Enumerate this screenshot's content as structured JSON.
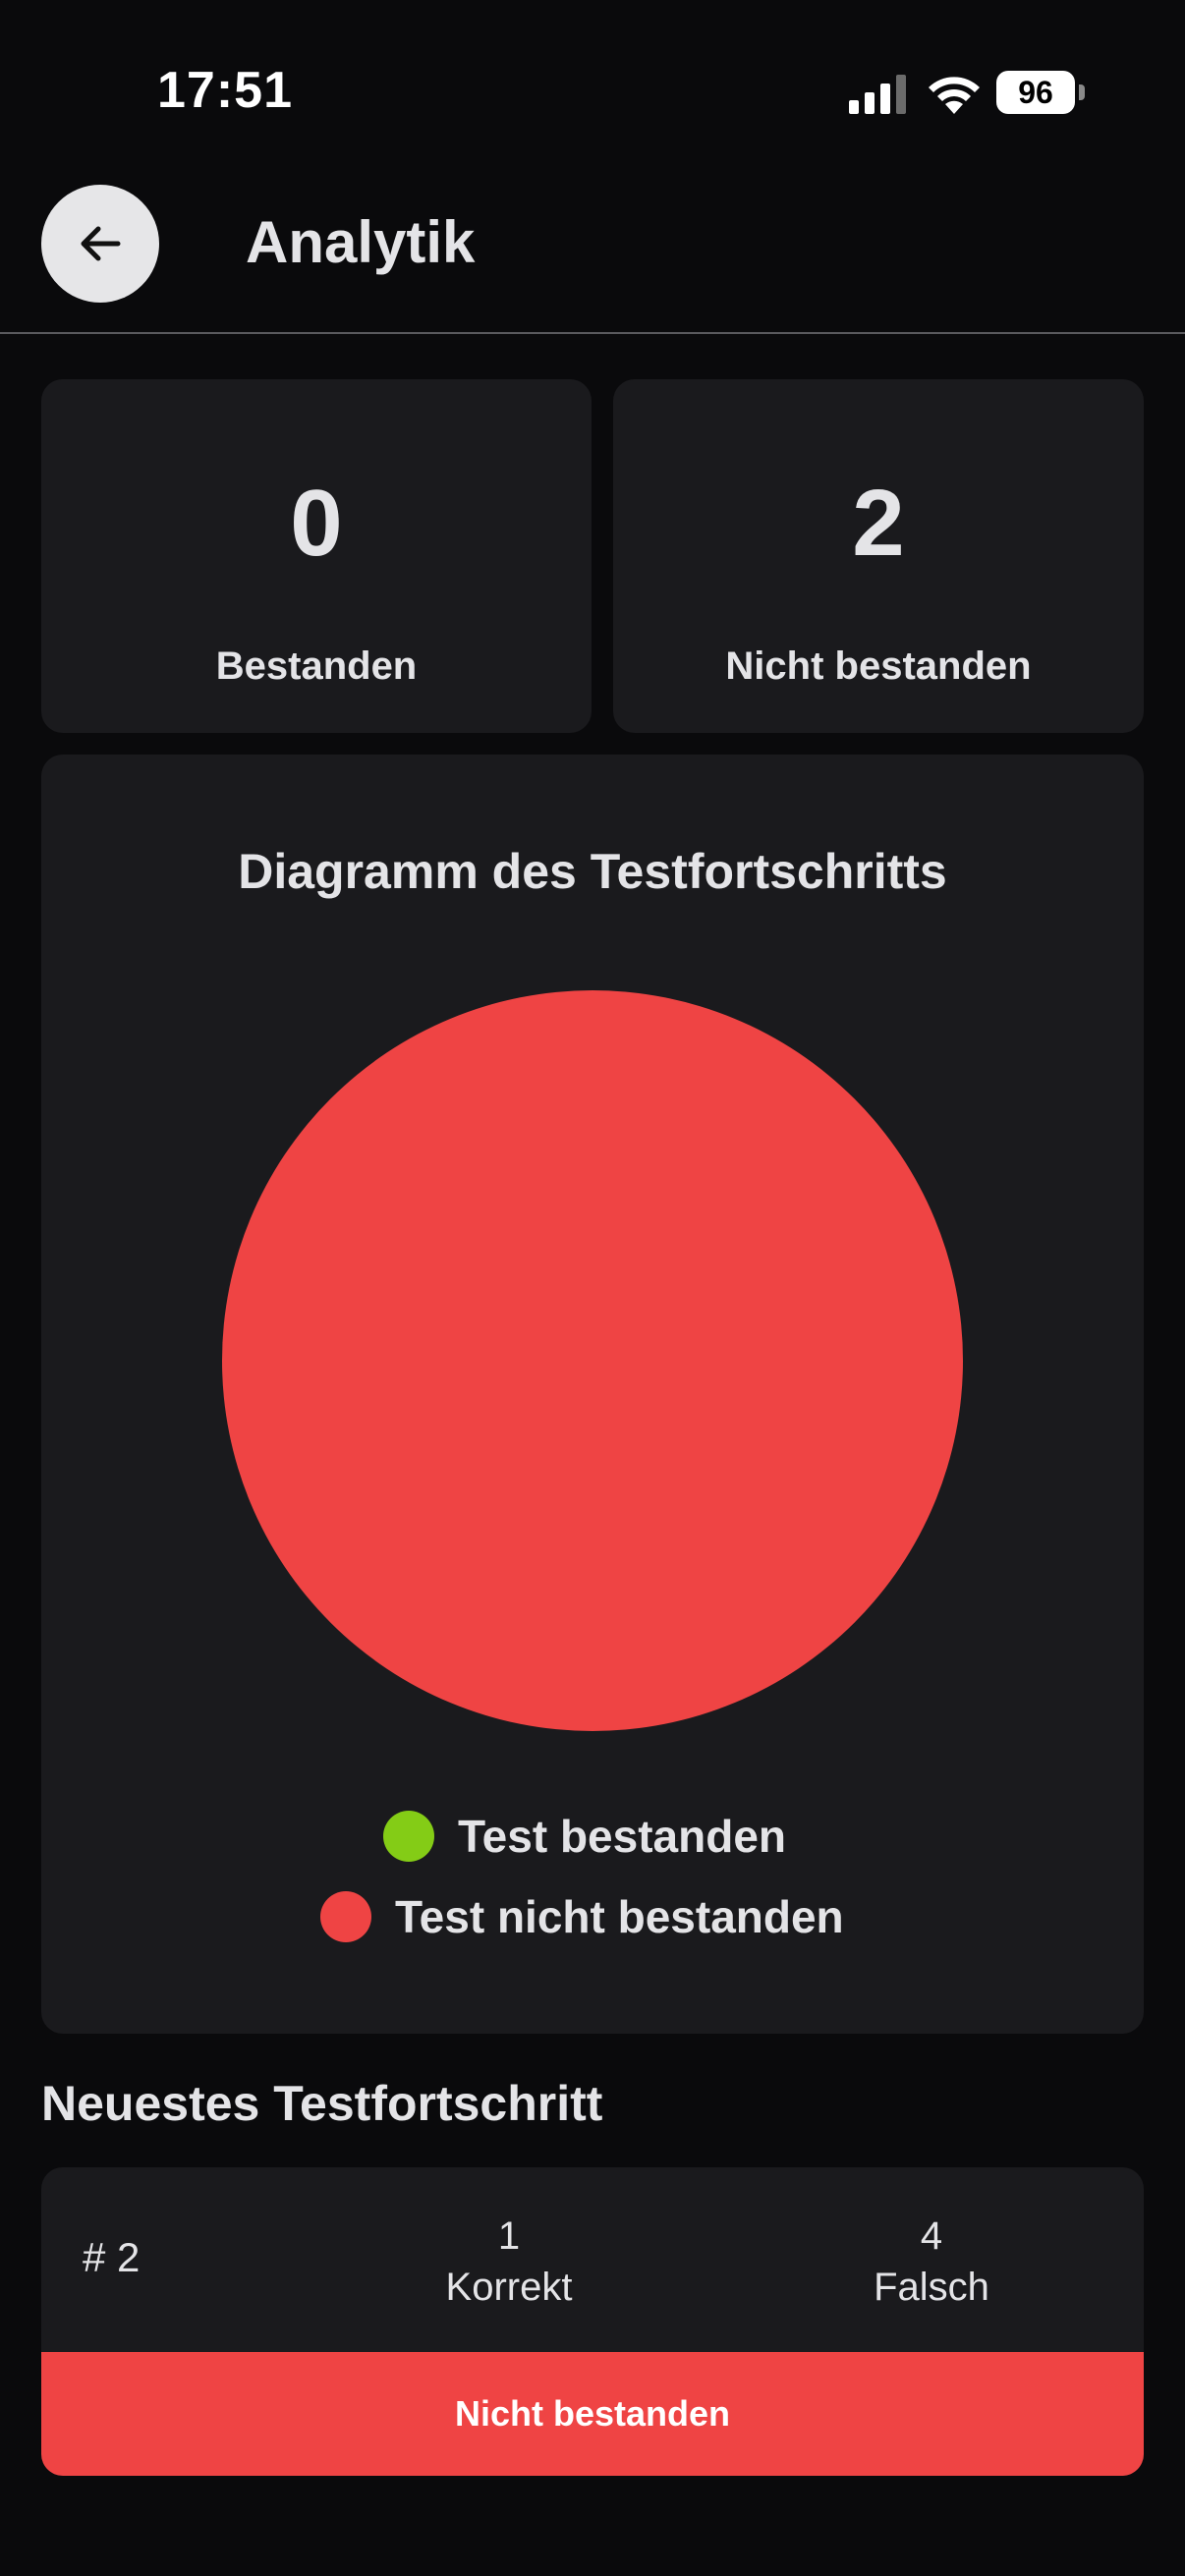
{
  "status_bar": {
    "time": "17:51",
    "battery": "96",
    "icons": [
      "signal-icon",
      "wifi-icon",
      "battery-icon"
    ]
  },
  "header": {
    "title": "Analytik",
    "back_icon": "arrow-left-icon"
  },
  "stats": {
    "passed": {
      "value": "0",
      "label": "Bestanden"
    },
    "failed": {
      "value": "2",
      "label": "Nicht bestanden"
    }
  },
  "chart": {
    "title": "Diagramm des Testfortschritts",
    "legend": [
      {
        "label": "Test bestanden",
        "color": "#84cc16"
      },
      {
        "label": "Test nicht bestanden",
        "color": "#ef4444"
      }
    ]
  },
  "chart_data": {
    "type": "pie",
    "title": "Diagramm des Testfortschritts",
    "categories": [
      "Test bestanden",
      "Test nicht bestanden"
    ],
    "values": [
      0,
      2
    ],
    "colors": [
      "#84cc16",
      "#ef4444"
    ],
    "legend_position": "bottom"
  },
  "latest": {
    "section_title": "Neuestes Testfortschritt",
    "id": "# 2",
    "correct": {
      "value": "1",
      "label": "Korrekt"
    },
    "wrong": {
      "value": "4",
      "label": "Falsch"
    },
    "status": "Nicht bestanden",
    "status_color": "#ef4444"
  },
  "colors": {
    "background": "#0a0a0c",
    "card": "#1a1a1d",
    "text": "#e4e4e7",
    "passed": "#84cc16",
    "failed": "#ef4444"
  }
}
